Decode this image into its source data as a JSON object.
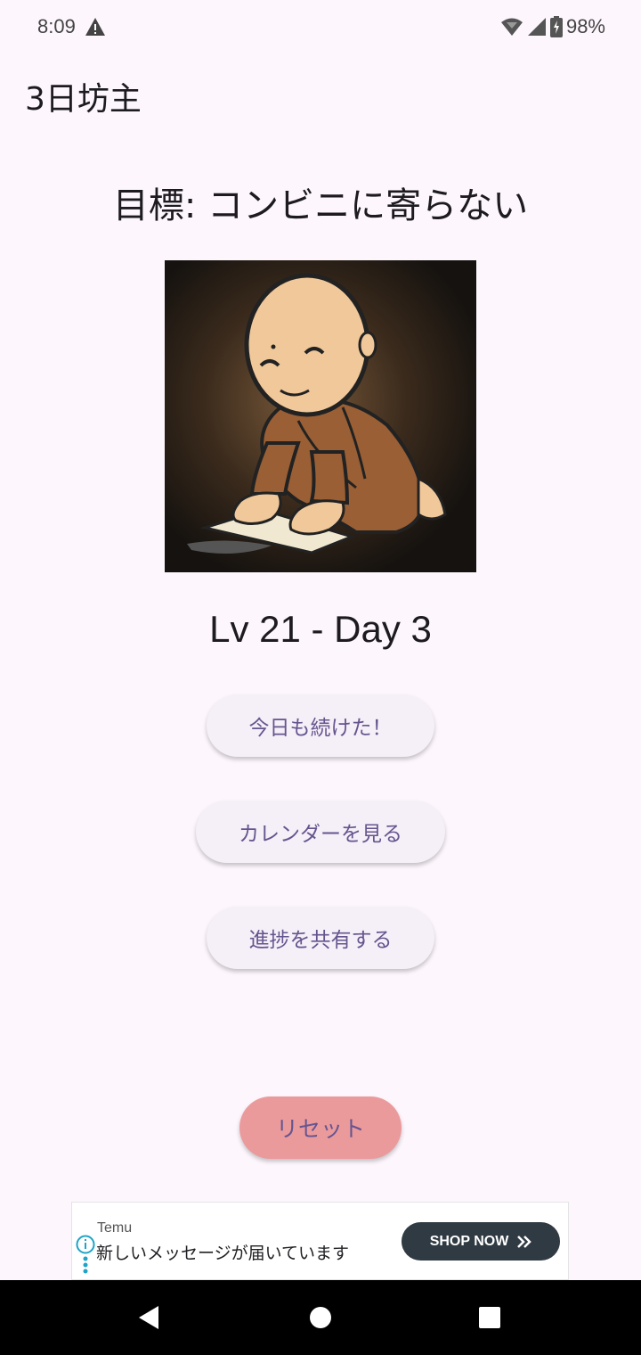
{
  "status": {
    "time": "8:09",
    "battery": "98%"
  },
  "app": {
    "title": "3日坊主"
  },
  "main": {
    "goal": "目標: コンビニに寄らない",
    "level": "Lv 21 - Day 3"
  },
  "buttons": {
    "continue": "今日も続けた！",
    "calendar": "カレンダーを見る",
    "share": "進捗を共有する",
    "reset": "リセット"
  },
  "ad": {
    "brand": "Temu",
    "text": "新しいメッセージが届いています",
    "cta": "SHOP NOW"
  },
  "colors": {
    "background": "#fdf7fd",
    "button_bg": "#f5eff7",
    "button_text": "#65558f",
    "reset_bg": "#eb9a9c"
  }
}
